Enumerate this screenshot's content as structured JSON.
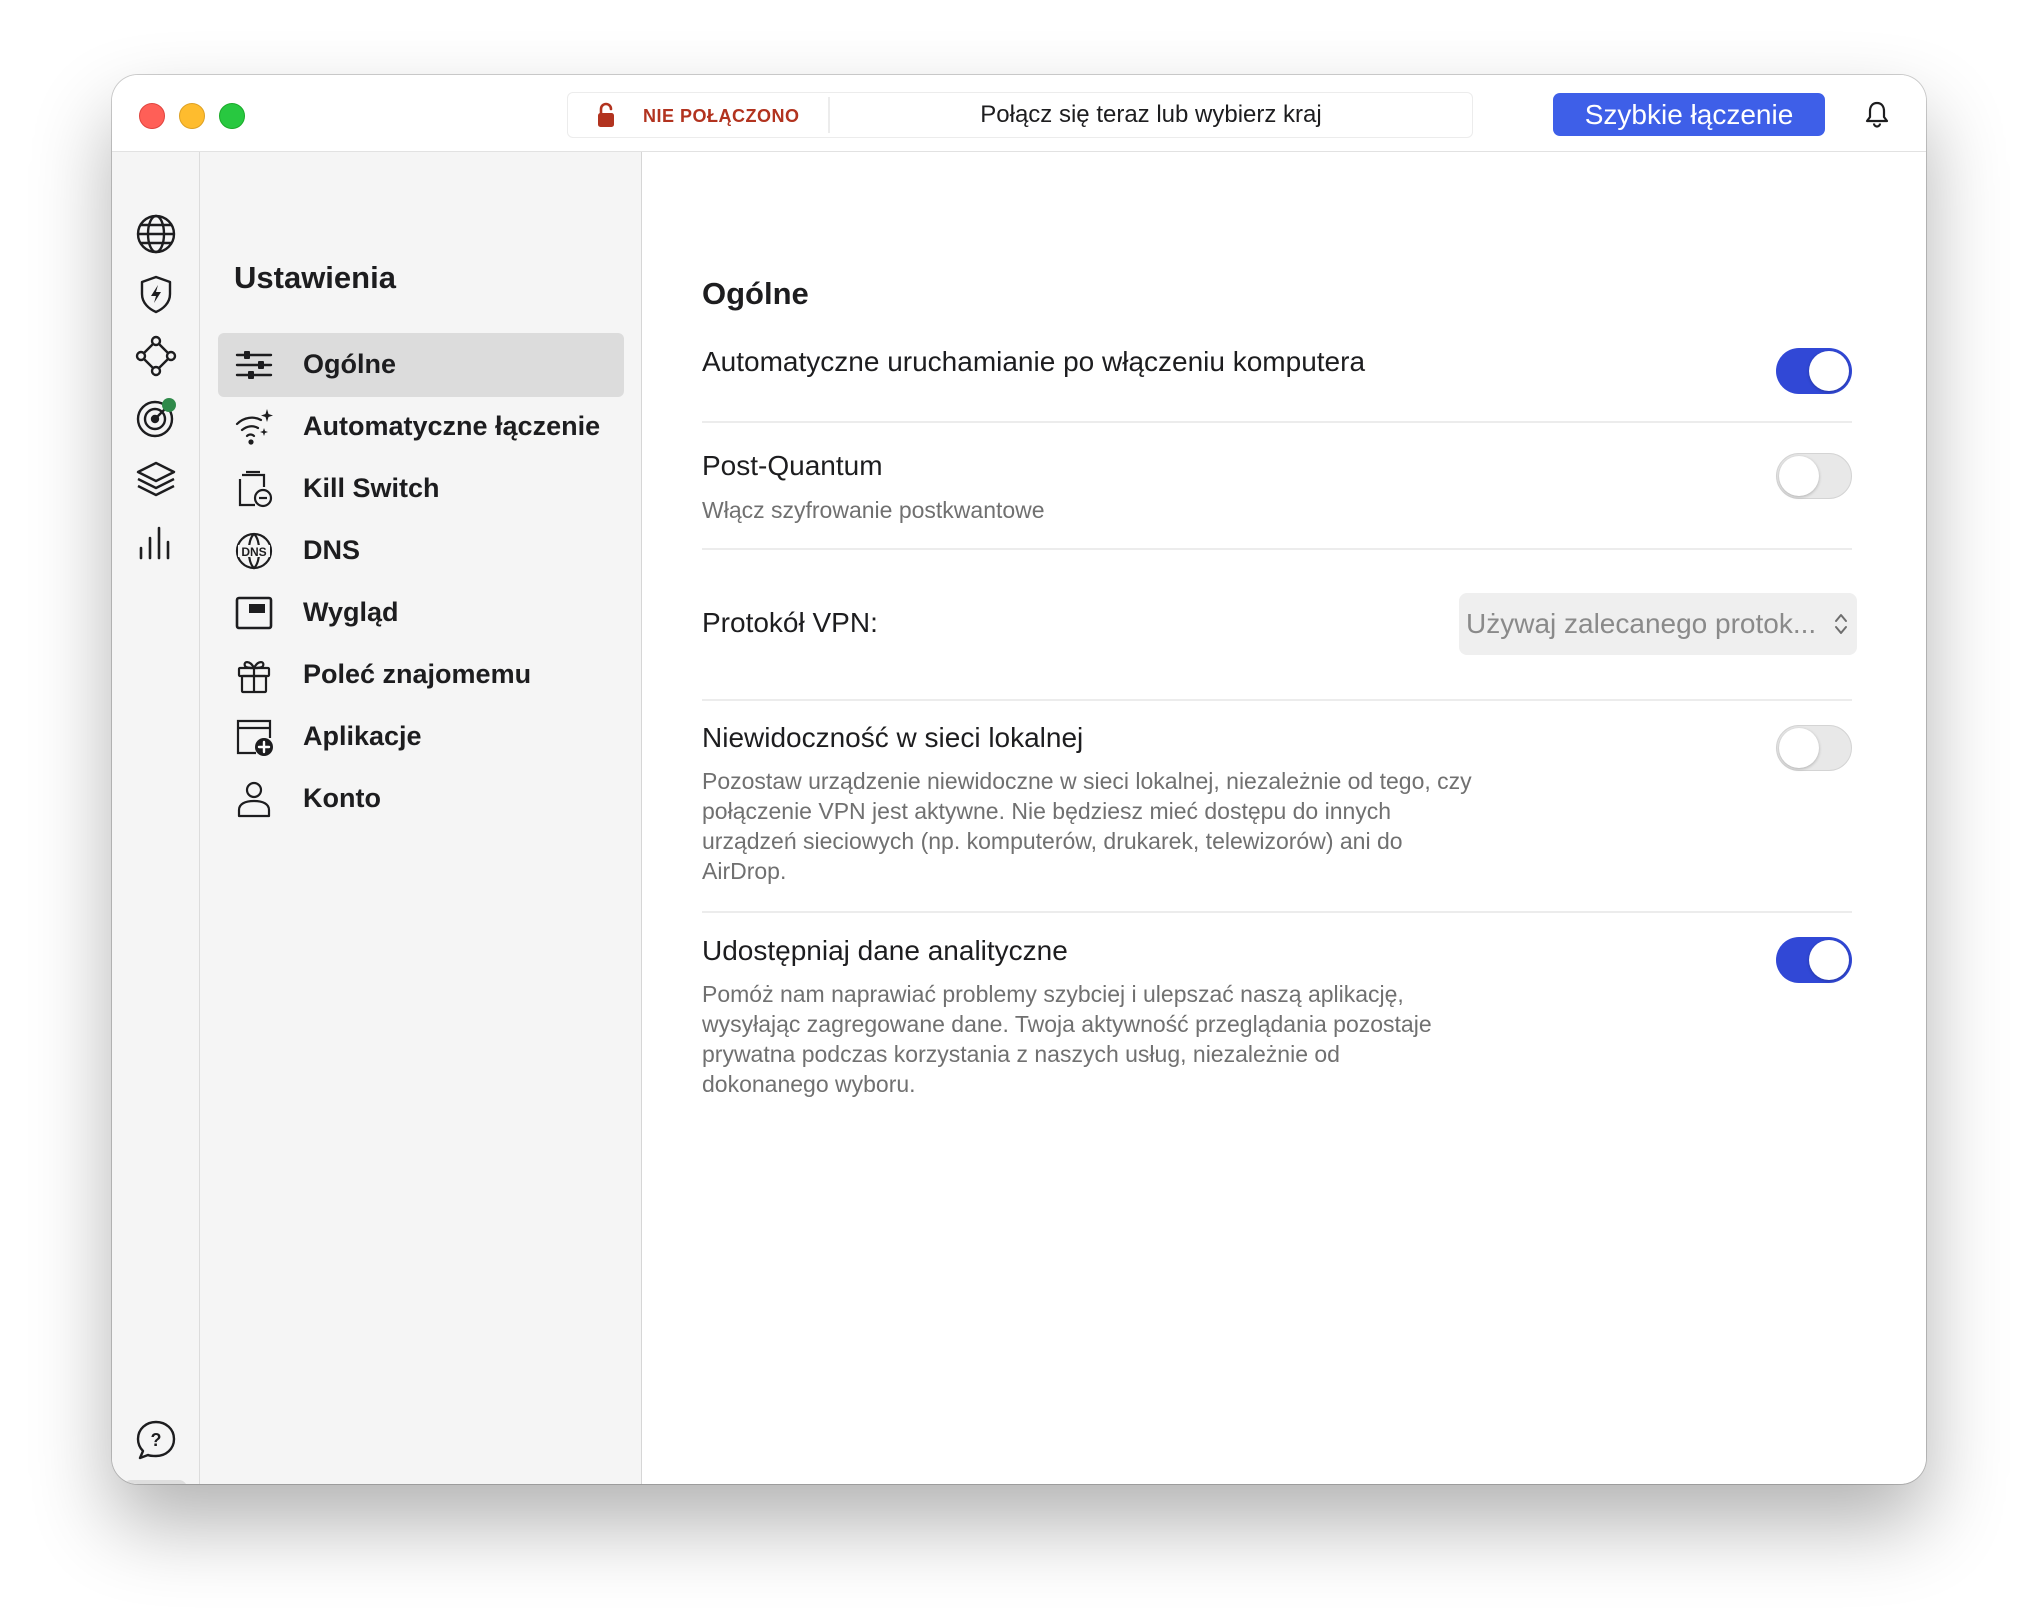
{
  "titlebar": {
    "status_label": "NIE POŁĄCZONO",
    "status_prompt": "Połącz się teraz lub wybierz kraj",
    "quick_connect_label": "Szybkie łączenie"
  },
  "colors": {
    "accent": "#3e5fe8",
    "toggle_on": "#3148d6",
    "status_red": "#b2331f",
    "notification_dot": "#2f8a4a"
  },
  "rail": {
    "items": [
      {
        "icon": "globe-icon"
      },
      {
        "icon": "shield-bolt-icon"
      },
      {
        "icon": "meshnet-icon"
      },
      {
        "icon": "threat-target-icon"
      },
      {
        "icon": "layers-icon"
      },
      {
        "icon": "stats-bars-icon"
      }
    ],
    "bottom": [
      {
        "icon": "help-chat-icon"
      },
      {
        "icon": "gear-icon",
        "active": true
      }
    ]
  },
  "sidebar": {
    "title": "Ustawienia",
    "items": [
      {
        "label": "Ogólne",
        "icon": "sliders-icon",
        "active": true
      },
      {
        "label": "Automatyczne łączenie",
        "icon": "wifi-sparkle-icon"
      },
      {
        "label": "Kill Switch",
        "icon": "kill-switch-icon"
      },
      {
        "label": "DNS",
        "icon": "dns-globe-icon"
      },
      {
        "label": "Wygląd",
        "icon": "appearance-window-icon"
      },
      {
        "label": "Poleć znajomemu",
        "icon": "gift-icon"
      },
      {
        "label": "Aplikacje",
        "icon": "app-add-icon"
      },
      {
        "label": "Konto",
        "icon": "user-icon"
      }
    ]
  },
  "content": {
    "section_title": "Ogólne",
    "settings": {
      "autostart": {
        "title": "Automatyczne uruchamianie po włączeniu komputera",
        "enabled": true
      },
      "post_quantum": {
        "title": "Post-Quantum",
        "description": "Włącz szyfrowanie postkwantowe",
        "enabled": false
      },
      "protocol": {
        "label": "Protokół VPN:",
        "value": "Używaj zalecanego protok..."
      },
      "lan_invisibility": {
        "title": "Niewidoczność w sieci lokalnej",
        "description": "Pozostaw urządzenie niewidoczne w sieci lokalnej, niezależnie od tego, czy połączenie VPN jest aktywne. Nie będziesz mieć dostępu do innych urządzeń sieciowych (np. komputerów, drukarek, telewizorów) ani do AirDrop.",
        "enabled": false
      },
      "analytics": {
        "title": "Udostępniaj dane analityczne",
        "description": "Pomóż nam naprawiać problemy szybciej i ulepszać naszą aplikację, wysyłając zagregowane dane. Twoja aktywność przeglądania pozostaje prywatna podczas korzystania z naszych usług, niezależnie od dokonanego wyboru.",
        "enabled": true
      }
    }
  }
}
